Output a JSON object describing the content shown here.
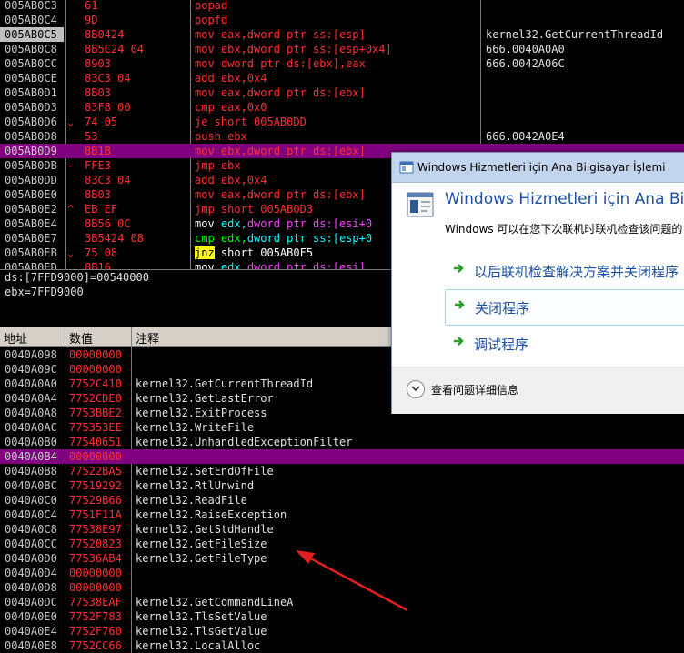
{
  "disasm": {
    "rows": [
      {
        "addr": "005AB0C3",
        "jm": "",
        "hex": "61",
        "asm": [
          [
            "popad",
            ""
          ]
        ],
        "cmt": "",
        "hl": false,
        "sel": false
      },
      {
        "addr": "005AB0C4",
        "jm": "",
        "hex": "9D",
        "asm": [
          [
            "popfd",
            ""
          ]
        ],
        "cmt": "",
        "hl": false,
        "sel": false
      },
      {
        "addr": "005AB0C5",
        "jm": "",
        "hex": "8B0424",
        "asm": [
          [
            "mov eax,dword ptr ss:[esp]",
            ""
          ]
        ],
        "cmt": "kernel32.GetCurrentThreadId",
        "hl": false,
        "sel": true
      },
      {
        "addr": "005AB0C8",
        "jm": "",
        "hex": "8B5C24 04",
        "asm": [
          [
            "mov ebx,dword ptr ss:[esp+0x4]",
            ""
          ]
        ],
        "cmt": "666.0040A0A0",
        "hl": false,
        "sel": false
      },
      {
        "addr": "005AB0CC",
        "jm": "",
        "hex": "8903",
        "asm": [
          [
            "mov dword ptr ds:[ebx],eax",
            ""
          ]
        ],
        "cmt": "666.0042A06C",
        "hl": false,
        "sel": false
      },
      {
        "addr": "005AB0CE",
        "jm": "",
        "hex": "83C3 04",
        "asm": [
          [
            "add ebx,0x4",
            ""
          ]
        ],
        "cmt": "",
        "hl": false,
        "sel": false
      },
      {
        "addr": "005AB0D1",
        "jm": "",
        "hex": "8B03",
        "asm": [
          [
            "mov eax,dword ptr ds:[ebx]",
            ""
          ]
        ],
        "cmt": "",
        "hl": false,
        "sel": false
      },
      {
        "addr": "005AB0D3",
        "jm": "",
        "hex": "83F8 00",
        "asm": [
          [
            "cmp eax,0x0",
            ""
          ]
        ],
        "cmt": "",
        "hl": false,
        "sel": false
      },
      {
        "addr": "005AB0D6",
        "jm": "⌄",
        "hex": "74 05",
        "asm": [
          [
            "je short 005AB0DD",
            ""
          ]
        ],
        "cmt": "",
        "hl": false,
        "sel": false
      },
      {
        "addr": "005AB0D8",
        "jm": "",
        "hex": "53",
        "asm": [
          [
            "push ebx",
            ""
          ]
        ],
        "cmt": "666.0042A0E4",
        "hl": false,
        "sel": false
      },
      {
        "addr": "005AB0D9",
        "jm": "",
        "hex": "8B1B",
        "asm": [
          [
            "mov ebx,dword ptr ds:[ebx]",
            ""
          ]
        ],
        "cmt": "",
        "hl": true,
        "sel": false
      },
      {
        "addr": "005AB0DB",
        "jm": "-",
        "hex": "FFE3",
        "asm": [
          [
            "jmp ebx",
            ""
          ]
        ],
        "cmt": "",
        "hl": false,
        "sel": false
      },
      {
        "addr": "005AB0DD",
        "jm": "",
        "hex": "83C3 04",
        "asm": [
          [
            "add ebx,0x4",
            ""
          ]
        ],
        "cmt": "",
        "hl": false,
        "sel": false
      },
      {
        "addr": "005AB0E0",
        "jm": "",
        "hex": "8B03",
        "asm": [
          [
            "mov eax,dword ptr ds:[ebx]",
            ""
          ]
        ],
        "cmt": "",
        "hl": false,
        "sel": false
      },
      {
        "addr": "005AB0E2",
        "jm": "^",
        "hex": "EB EF",
        "asm": [
          [
            "jmp short 005AB0D3",
            ""
          ]
        ],
        "cmt": "",
        "hl": false,
        "sel": false
      },
      {
        "addr": "005AB0E4",
        "jm": "",
        "hex": "8B56 0C",
        "asm": [
          [
            "mov ",
            "wm"
          ],
          [
            "edx,",
            "wmc"
          ],
          [
            "dword ptr ds:[esi+0",
            "wmm"
          ]
        ],
        "cmt": "",
        "hl": false,
        "sel": false
      },
      {
        "addr": "005AB0E7",
        "jm": "",
        "hex": "3B5424 08",
        "asm": [
          [
            "cmp ",
            "wmg"
          ],
          [
            "edx,",
            "wmg"
          ],
          [
            "dword ptr ss:[esp+0",
            "wmc"
          ]
        ],
        "cmt": "",
        "hl": false,
        "sel": false
      },
      {
        "addr": "005AB0EB",
        "jm": "⌄",
        "hex": "75 08",
        "asm": [
          [
            "jnz",
            "jnz"
          ],
          [
            " short 005AB0F5",
            "wm"
          ]
        ],
        "cmt": "",
        "hl": false,
        "sel": false
      },
      {
        "addr": "005AB0ED",
        "jm": "",
        "hex": "8B16",
        "asm": [
          [
            "mov ",
            "wm"
          ],
          [
            "edx,",
            "wmc"
          ],
          [
            "dword ptr ds:[esi]",
            "wmm"
          ]
        ],
        "cmt": "",
        "hl": false,
        "sel": false
      }
    ]
  },
  "info": {
    "line1": "ds:[7FFD9000]=00540000",
    "line2": "ebx=7FFD9000"
  },
  "dump": {
    "headers": {
      "addr": "地址",
      "value": "数值",
      "comment": "注释"
    },
    "rows": [
      {
        "addr": "0040A098",
        "val": "00000000",
        "cmt": "",
        "hl": false
      },
      {
        "addr": "0040A09C",
        "val": "00000000",
        "cmt": "",
        "hl": false
      },
      {
        "addr": "0040A0A0",
        "val": "7752C410",
        "cmt": "kernel32.GetCurrentThreadId",
        "hl": false
      },
      {
        "addr": "0040A0A4",
        "val": "7752CDE0",
        "cmt": "kernel32.GetLastError",
        "hl": false
      },
      {
        "addr": "0040A0A8",
        "val": "7753BBE2",
        "cmt": "kernel32.ExitProcess",
        "hl": false
      },
      {
        "addr": "0040A0AC",
        "val": "775353EE",
        "cmt": "kernel32.WriteFile",
        "hl": false
      },
      {
        "addr": "0040A0B0",
        "val": "77540651",
        "cmt": "kernel32.UnhandledExceptionFilter",
        "hl": false
      },
      {
        "addr": "0040A0B4",
        "val": "00000000",
        "cmt": "",
        "hl": true
      },
      {
        "addr": "0040A0B8",
        "val": "77522BA5",
        "cmt": "kernel32.SetEndOfFile",
        "hl": false
      },
      {
        "addr": "0040A0BC",
        "val": "77519292",
        "cmt": "kernel32.RtlUnwind",
        "hl": false
      },
      {
        "addr": "0040A0C0",
        "val": "77529B66",
        "cmt": "kernel32.ReadFile",
        "hl": false
      },
      {
        "addr": "0040A0C4",
        "val": "7751F11A",
        "cmt": "kernel32.RaiseException",
        "hl": false
      },
      {
        "addr": "0040A0C8",
        "val": "77538E97",
        "cmt": "kernel32.GetStdHandle",
        "hl": false
      },
      {
        "addr": "0040A0CC",
        "val": "77520823",
        "cmt": "kernel32.GetFileSize",
        "hl": false
      },
      {
        "addr": "0040A0D0",
        "val": "77536AB4",
        "cmt": "kernel32.GetFileType",
        "hl": false
      },
      {
        "addr": "0040A0D4",
        "val": "00000000",
        "cmt": "",
        "hl": false
      },
      {
        "addr": "0040A0D8",
        "val": "00000000",
        "cmt": "",
        "hl": false
      },
      {
        "addr": "0040A0DC",
        "val": "77538EAF",
        "cmt": "kernel32.GetCommandLineA",
        "hl": false
      },
      {
        "addr": "0040A0E0",
        "val": "7752F783",
        "cmt": "kernel32.TlsSetValue",
        "hl": false
      },
      {
        "addr": "0040A0E4",
        "val": "7752F760",
        "cmt": "kernel32.TlsGetValue",
        "hl": false
      },
      {
        "addr": "0040A0E8",
        "val": "7752CC66",
        "cmt": "kernel32.LocalAlloc",
        "hl": false
      }
    ]
  },
  "dialog": {
    "title": "Windows Hizmetleri için Ana Bilgisayar İşlemi",
    "heading": "Windows Hizmetleri için Ana Bilgis",
    "description": "Windows 可以在您下次联机时联机检查该问题的",
    "options": [
      {
        "label": "以后联机检查解决方案并关闭程序"
      },
      {
        "label": "关闭程序"
      },
      {
        "label": "调试程序"
      }
    ],
    "details_label": "查看问题详细信息"
  },
  "colors": {
    "highlight_row": "#800080",
    "code_text": "#ff3030",
    "dialog_link": "#1e50a2",
    "annotation_arrow": "#e02020"
  }
}
